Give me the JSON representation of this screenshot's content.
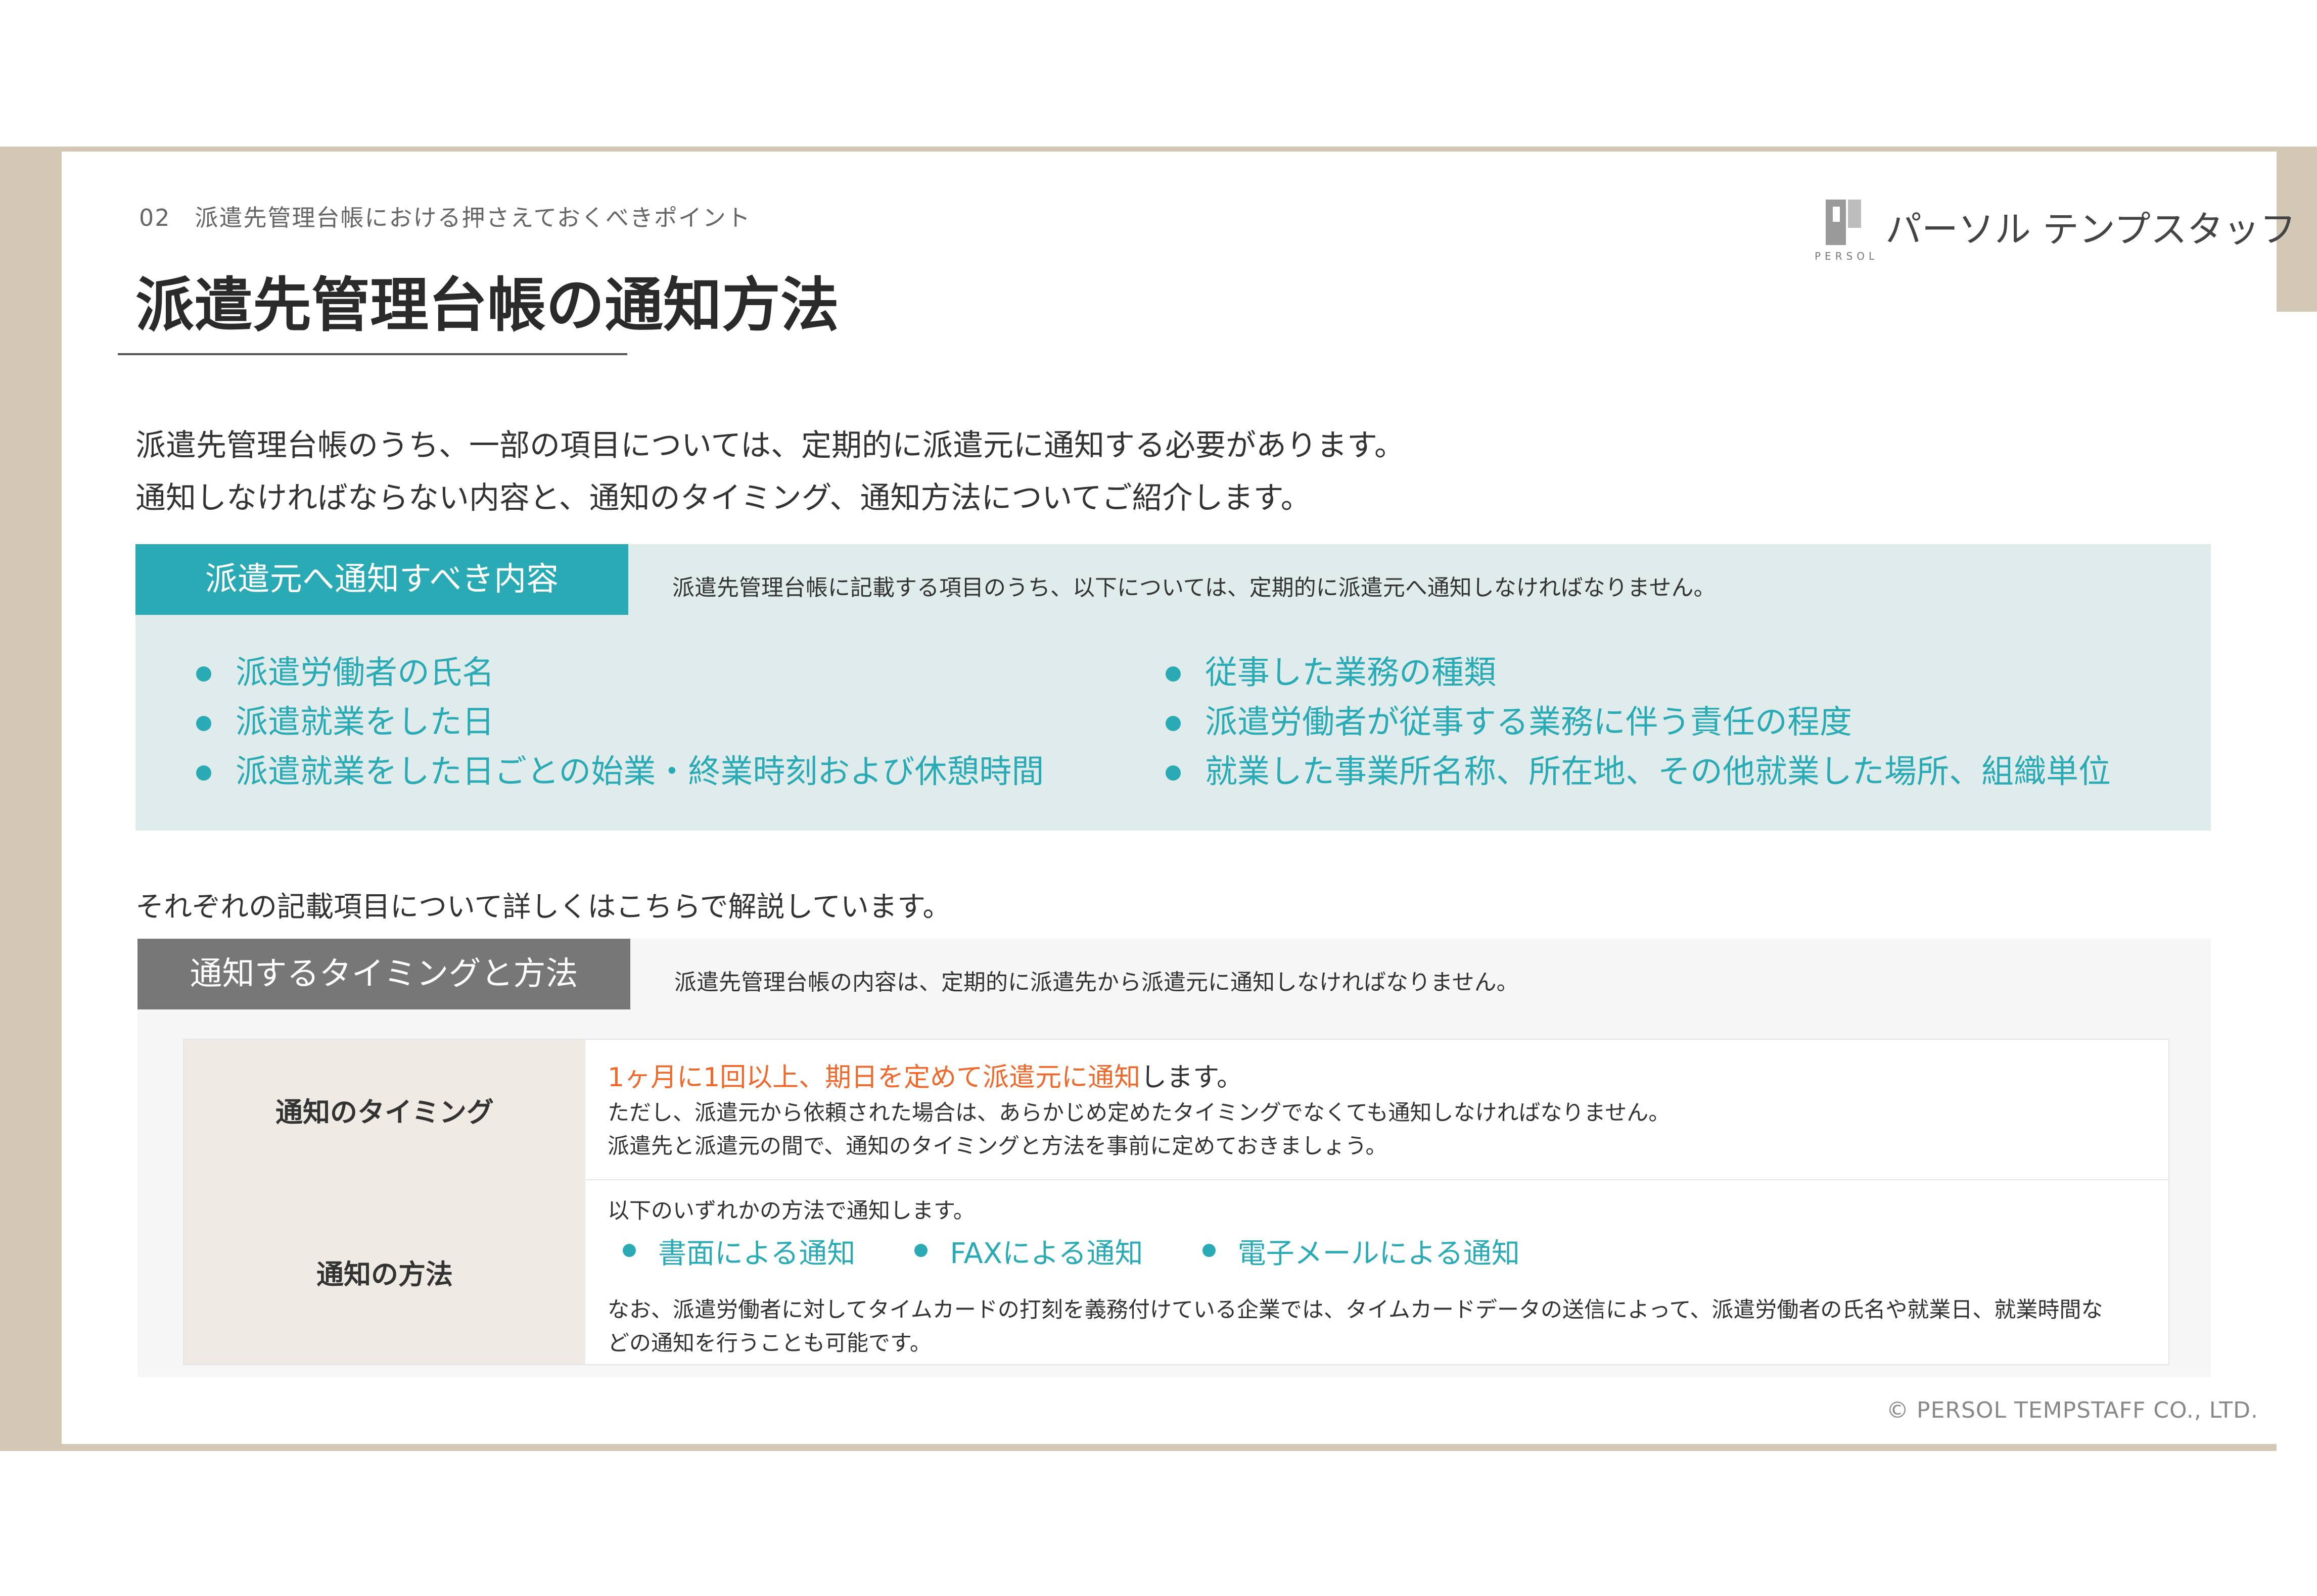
{
  "header": {
    "section_label": "02　派遣先管理台帳における押さえておくべきポイント",
    "title": "派遣先管理台帳の通知方法"
  },
  "logo": {
    "sub": "PERSOL",
    "name": "パーソル テンプスタッフ"
  },
  "intro": {
    "line1": "派遣先管理台帳のうち、一部の項目については、定期的に派遣元に通知する必要があります。",
    "line2": "通知しなければならない内容と、通知のタイミング、通知方法についてご紹介します。"
  },
  "notify_contents": {
    "heading": "派遣元へ通知すべき内容",
    "note": "派遣先管理台帳に記載する項目のうち、以下については、定期的に派遣元へ通知しなければなりません。",
    "left_items": [
      "派遣労働者の氏名",
      "派遣就業をした日",
      "派遣就業をした日ごとの始業・終業時刻および休憩時間"
    ],
    "right_items": [
      "従事した業務の種類",
      "派遣労働者が従事する業務に伴う責任の程度",
      "就業した事業所名称、所在地、その他就業した場所、組織単位"
    ]
  },
  "detail_note": "それぞれの記載項目について詳しくはこちらで解説しています。",
  "timing_method": {
    "heading": "通知するタイミングと方法",
    "note": "派遣先管理台帳の内容は、定期的に派遣先から派遣元に通知しなければなりません。",
    "timing": {
      "label": "通知のタイミング",
      "highlight": "1ヶ月に1回以上、期日を定めて派遣元に通知",
      "main_suffix": "します。",
      "line2": "ただし、派遣元から依頼された場合は、あらかじめ定めたタイミングでなくても通知しなければなりません。",
      "line3": "派遣先と派遣元の間で、通知のタイミングと方法を事前に定めておきましょう。"
    },
    "method": {
      "label": "通知の方法",
      "intro": "以下のいずれかの方法で通知します。",
      "options": [
        "書面による通知",
        "FAXによる通知",
        "電子メールによる通知"
      ],
      "note_line1": "なお、派遣労働者に対してタイムカードの打刻を義務付けている企業では、タイムカードデータの送信によって、派遣労働者の氏名や就業日、就業時間な",
      "note_line2": "どの通知を行うことも可能です。"
    }
  },
  "footer": {
    "copyright": "© PERSOL TEMPSTAFF CO., LTD."
  },
  "colors": {
    "teal": "#2aaab4",
    "orange": "#ee6a2c",
    "frame": "#d3c8b6",
    "gray_header": "#777777"
  }
}
